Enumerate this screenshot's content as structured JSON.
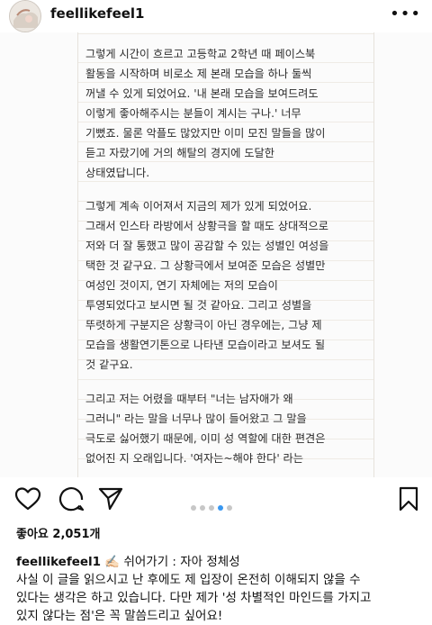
{
  "header": {
    "username": "feellikefeel1",
    "more_icon": "more-options-icon"
  },
  "post": {
    "paragraphs": [
      [
        "그렇게 시간이 흐르고 고등학교 2학년 때 페이스북",
        "활동을 시작하며 비로소 제 본래 모습을 하나 둘씩",
        "꺼낼 수 있게 되었어요. '내 본래 모습을 보여드려도",
        "이렇게 좋아해주시는 분들이 계시는 구나.' 너무",
        "기뻤죠. 물론 악플도 많았지만 이미 모진 말들을 많이",
        "듣고 자랐기에 거의 해탈의 경지에 도달한",
        "상태였답니다."
      ],
      [
        "그렇게 계속 이어져서 지금의 제가 있게 되었어요.",
        "그래서 인스타 라방에서 상황극을 할 때도 상대적으로",
        "저와 더 잘 통했고 많이 공감할 수 있는 성별인 여성을",
        "택한 것 같구요. 그 상황극에서 보여준 모습은 성별만",
        "여성인 것이지, 연기 자체에는 저의 모습이",
        "투영되었다고 보시면 될 것 같아요. 그리고 성별을",
        "뚜렷하게 구분지은 상황극이 아닌 경우에는, 그냥 제",
        "모습을 생활연기톤으로 나타낸 모습이라고 보셔도 될",
        "것 같구요."
      ],
      [
        "그리고 저는 어렸을 때부터 \"너는 남자애가 왜",
        "그러니\" 라는 말을 너무나 많이 들어왔고 그 말을",
        "극도로 싫어했기 때문에, 이미 성 역할에 대한 편견은",
        "없어진 지 오래입니다. '여자는~해야 한다' 라는"
      ]
    ],
    "carousel": {
      "count": 5,
      "active_index": 3,
      "active_color": "#3897f0"
    }
  },
  "actions": {
    "icons": [
      "heart-icon",
      "comment-icon",
      "share-icon",
      "bookmark-icon"
    ]
  },
  "likes_text": "좋아요 2,051개",
  "caption": {
    "username": "feellikefeel1",
    "title": " ✍🏻 쉬어가기 : 자아 정체성",
    "lines": [
      "사실 이 글을 읽으시고 난 후에도 제 입장이 온전히 이해되지 않을 수",
      "있다는 생각은 하고 있습니다. 다만 제가 '성 차별적인 마인드를 가지고",
      "있지 않다는 점'은 꼭 말씀드리고 싶어요!"
    ]
  }
}
